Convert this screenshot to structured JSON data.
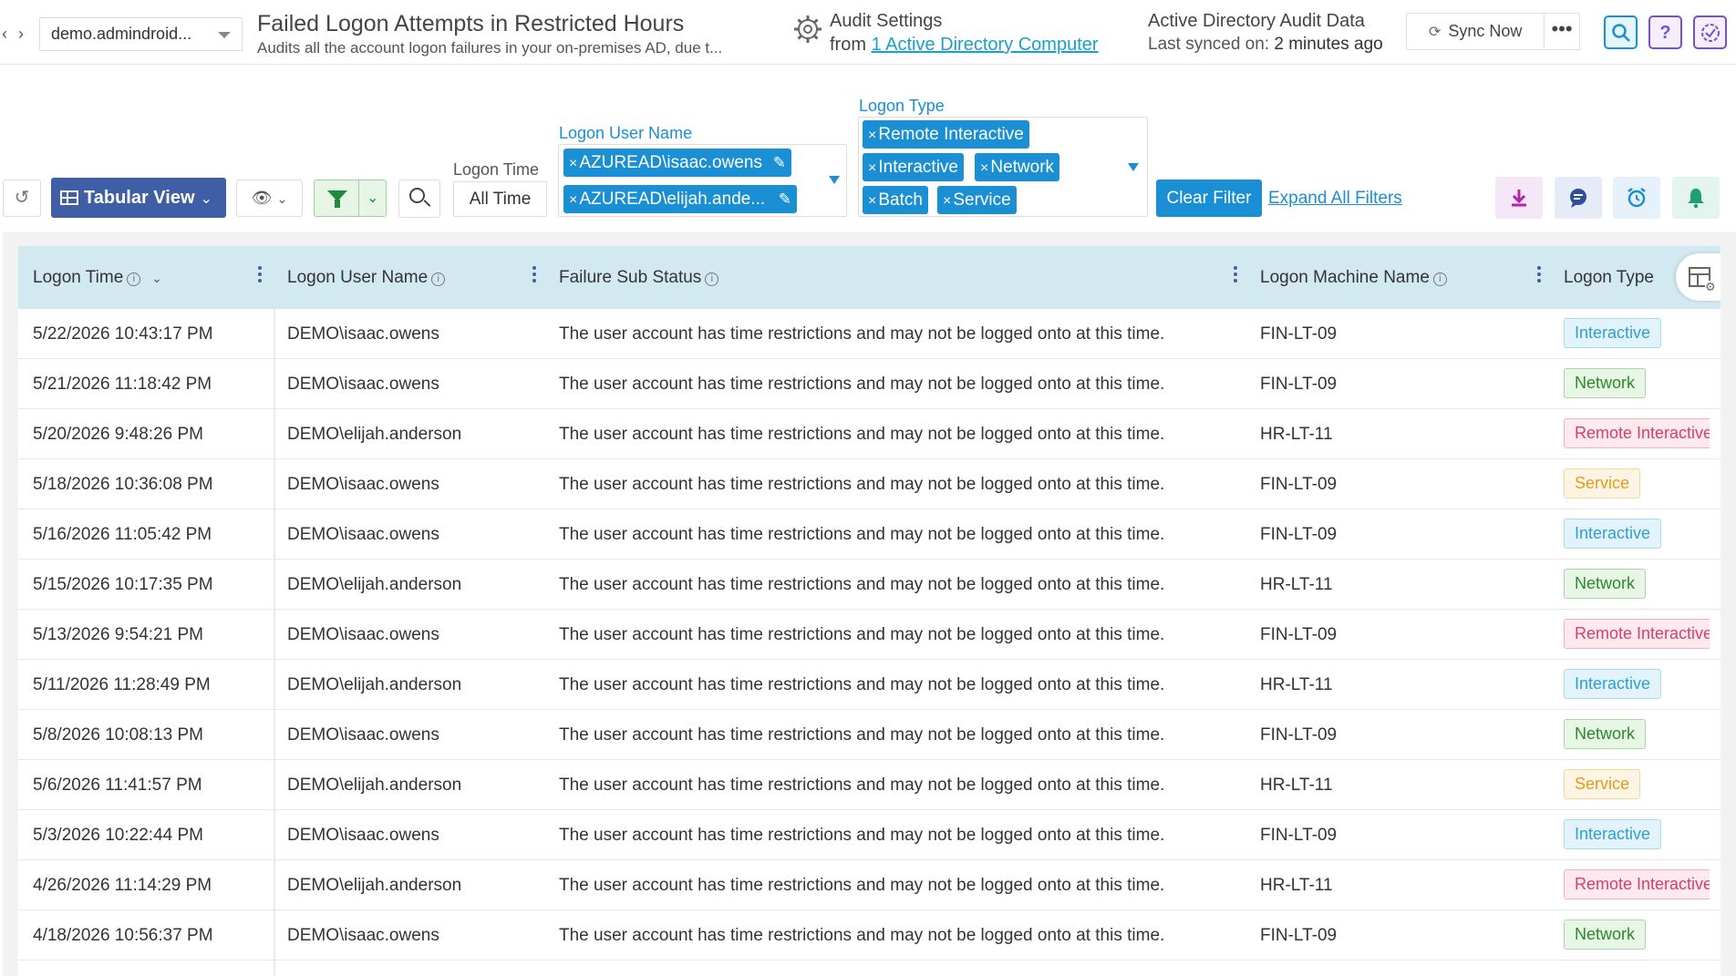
{
  "header": {
    "domain": "demo.admindroid...",
    "title": "Failed Logon Attempts in Restricted Hours",
    "description": "Audits all the account logon failures in your on-premises AD, due t...",
    "audit_settings_title": "Audit Settings",
    "audit_from": "from",
    "audit_link": "1 Active Directory Computer",
    "data_title": "Active Directory Audit Data",
    "last_synced_label": "Last synced on:",
    "last_synced_value": "2 minutes ago",
    "sync_label": "Sync Now",
    "more_label": "•••",
    "help_label": "?"
  },
  "toolbar": {
    "view_label": "Tabular View",
    "logon_time_label": "Logon Time",
    "logon_time_value": "All Time",
    "user_name_label": "Logon User Name",
    "user_chips": [
      "AZUREAD\\isaac.owens",
      "AZUREAD\\elijah.ande..."
    ],
    "logon_type_label": "Logon Type",
    "type_chips": [
      "Remote Interactive",
      "Interactive",
      "Network",
      "Batch",
      "Service"
    ],
    "clear_filter_label": "Clear Filter",
    "expand_filters_label": "Expand All Filters"
  },
  "table": {
    "columns": [
      "Logon Time",
      "Logon User Name",
      "Failure Sub Status",
      "Logon Machine Name",
      "Logon Type"
    ],
    "rows": [
      [
        "5/22/2026 10:43:17 PM",
        "DEMO\\isaac.owens",
        "The user account has time restrictions and may not be logged onto at this time.",
        "FIN-LT-09",
        "Interactive"
      ],
      [
        "5/21/2026 11:18:42 PM",
        "DEMO\\isaac.owens",
        "The user account has time restrictions and may not be logged onto at this time.",
        "FIN-LT-09",
        "Network"
      ],
      [
        "5/20/2026 9:48:26 PM",
        "DEMO\\elijah.anderson",
        "The user account has time restrictions and may not be logged onto at this time.",
        "HR-LT-11",
        "Remote Interactive"
      ],
      [
        "5/18/2026 10:36:08 PM",
        "DEMO\\isaac.owens",
        "The user account has time restrictions and may not be logged onto at this time.",
        "FIN-LT-09",
        "Service"
      ],
      [
        "5/16/2026 11:05:42 PM",
        "DEMO\\isaac.owens",
        "The user account has time restrictions and may not be logged onto at this time.",
        "FIN-LT-09",
        "Interactive"
      ],
      [
        "5/15/2026 10:17:35 PM",
        "DEMO\\elijah.anderson",
        "The user account has time restrictions and may not be logged onto at this time.",
        "HR-LT-11",
        "Network"
      ],
      [
        "5/13/2026 9:54:21 PM",
        "DEMO\\isaac.owens",
        "The user account has time restrictions and may not be logged onto at this time.",
        "FIN-LT-09",
        "Remote Interactive"
      ],
      [
        "5/11/2026 11:28:49 PM",
        "DEMO\\elijah.anderson",
        "The user account has time restrictions and may not be logged onto at this time.",
        "HR-LT-11",
        "Interactive"
      ],
      [
        "5/8/2026 10:08:13 PM",
        "DEMO\\isaac.owens",
        "The user account has time restrictions and may not be logged onto at this time.",
        "FIN-LT-09",
        "Network"
      ],
      [
        "5/6/2026 11:41:57 PM",
        "DEMO\\elijah.anderson",
        "The user account has time restrictions and may not be logged onto at this time.",
        "HR-LT-11",
        "Service"
      ],
      [
        "5/3/2026 10:22:44 PM",
        "DEMO\\isaac.owens",
        "The user account has time restrictions and may not be logged onto at this time.",
        "FIN-LT-09",
        "Interactive"
      ],
      [
        "4/26/2026 11:14:29 PM",
        "DEMO\\elijah.anderson",
        "The user account has time restrictions and may not be logged onto at this time.",
        "HR-LT-11",
        "Remote Interactive"
      ],
      [
        "4/18/2026 10:56:37 PM",
        "DEMO\\isaac.owens",
        "The user account has time restrictions and may not be logged onto at this time.",
        "FIN-LT-09",
        "Network"
      ]
    ]
  },
  "badge_colors": {
    "Interactive": "#2f9fd3",
    "Network": "#2b8a2b",
    "Remote Interactive": "#d6406a",
    "Service": "#e39b1a"
  }
}
